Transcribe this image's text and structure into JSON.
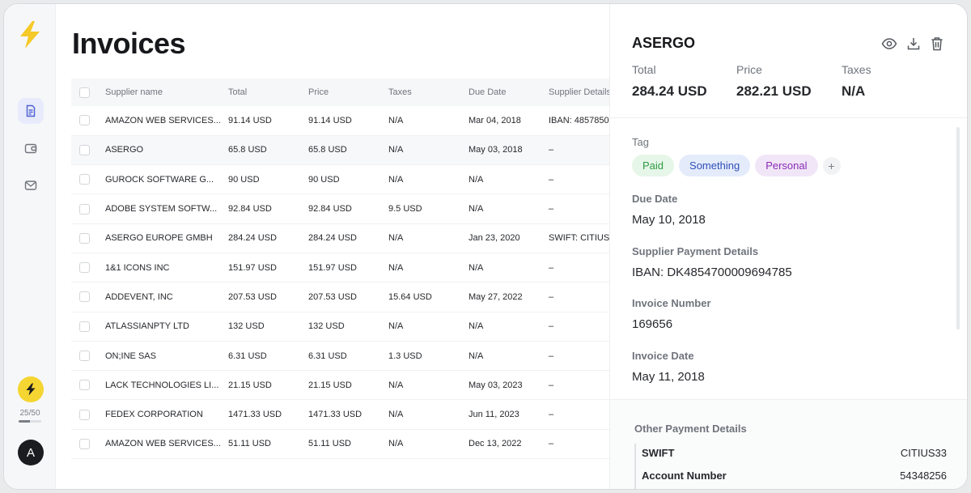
{
  "app": {
    "usage": {
      "label": "25/50",
      "used": 25,
      "limit": 50
    },
    "avatar_initial": "A"
  },
  "page": {
    "title": "Invoices"
  },
  "table": {
    "headers": [
      "Supplier name",
      "Total",
      "Price",
      "Taxes",
      "Due Date",
      "Supplier Details"
    ],
    "rows": [
      {
        "supplier": "AMAZON WEB SERVICES...",
        "total": "91.14 USD",
        "price": "91.14 USD",
        "taxes": "N/A",
        "due": "Mar 04, 2018",
        "details": "IBAN: 4857850"
      },
      {
        "supplier": "ASERGO",
        "total": "65.8 USD",
        "price": "65.8 USD",
        "taxes": "N/A",
        "due": "May 03, 2018",
        "details": "–"
      },
      {
        "supplier": "GUROCK SOFTWARE G...",
        "total": "90 USD",
        "price": "90 USD",
        "taxes": "N/A",
        "due": "N/A",
        "details": "–"
      },
      {
        "supplier": "ADOBE SYSTEM SOFTW...",
        "total": "92.84 USD",
        "price": "92.84 USD",
        "taxes": "9.5 USD",
        "due": "N/A",
        "details": "–"
      },
      {
        "supplier": "ASERGO EUROPE GMBH",
        "total": "284.24 USD",
        "price": "284.24 USD",
        "taxes": "N/A",
        "due": "Jan 23, 2020",
        "details": "SWIFT: CITIUS"
      },
      {
        "supplier": "1&1 ICONS INC",
        "total": "151.97 USD",
        "price": "151.97 USD",
        "taxes": "N/A",
        "due": "N/A",
        "details": "–"
      },
      {
        "supplier": "ADDEVENT, INC",
        "total": "207.53 USD",
        "price": "207.53 USD",
        "taxes": "15.64 USD",
        "due": "May 27, 2022",
        "details": "–"
      },
      {
        "supplier": "ATLASSIANPTY LTD",
        "total": "132 USD",
        "price": "132 USD",
        "taxes": "N/A",
        "due": "N/A",
        "details": "–"
      },
      {
        "supplier": "ON;INE SAS",
        "total": "6.31 USD",
        "price": "6.31 USD",
        "taxes": "1.3 USD",
        "due": "N/A",
        "details": "–"
      },
      {
        "supplier": "LACK TECHNOLOGIES LI...",
        "total": "21.15 USD",
        "price": "21.15 USD",
        "taxes": "N/A",
        "due": "May 03, 2023",
        "details": "–"
      },
      {
        "supplier": "FEDEX CORPORATION",
        "total": "1471.33 USD",
        "price": "1471.33 USD",
        "taxes": "N/A",
        "due": "Jun 11, 2023",
        "details": "–"
      },
      {
        "supplier": "AMAZON WEB SERVICES...",
        "total": "51.11 USD",
        "price": "51.11 USD",
        "taxes": "N/A",
        "due": "Dec 13, 2022",
        "details": "–"
      }
    ]
  },
  "detail": {
    "supplier": "ASERGO",
    "summary": [
      {
        "label": "Total",
        "value": "284.24 USD"
      },
      {
        "label": "Price",
        "value": "282.21 USD"
      },
      {
        "label": "Taxes",
        "value": "N/A"
      }
    ],
    "tag_label": "Tag",
    "tags": [
      "Paid",
      "Something",
      "Personal"
    ],
    "add_tag": "+",
    "fields": [
      {
        "label": "Due Date",
        "value": "May 10, 2018"
      },
      {
        "label": "Supplier Payment Details",
        "value": "IBAN: DK4854700009694785"
      },
      {
        "label": "Invoice Number",
        "value": "169656"
      },
      {
        "label": "Invoice Date",
        "value": "May 11, 2018"
      }
    ],
    "other": {
      "title": "Other Payment Details",
      "rows": [
        {
          "key": "SWIFT",
          "value": "CITIUS33"
        },
        {
          "key": "Account Number",
          "value": "54348256"
        }
      ]
    }
  },
  "colors": {
    "accent_yellow": "#f5d531",
    "tag_paid": "#2f9b44",
    "tag_something": "#2f4fb8",
    "tag_personal": "#8a2cb4"
  }
}
